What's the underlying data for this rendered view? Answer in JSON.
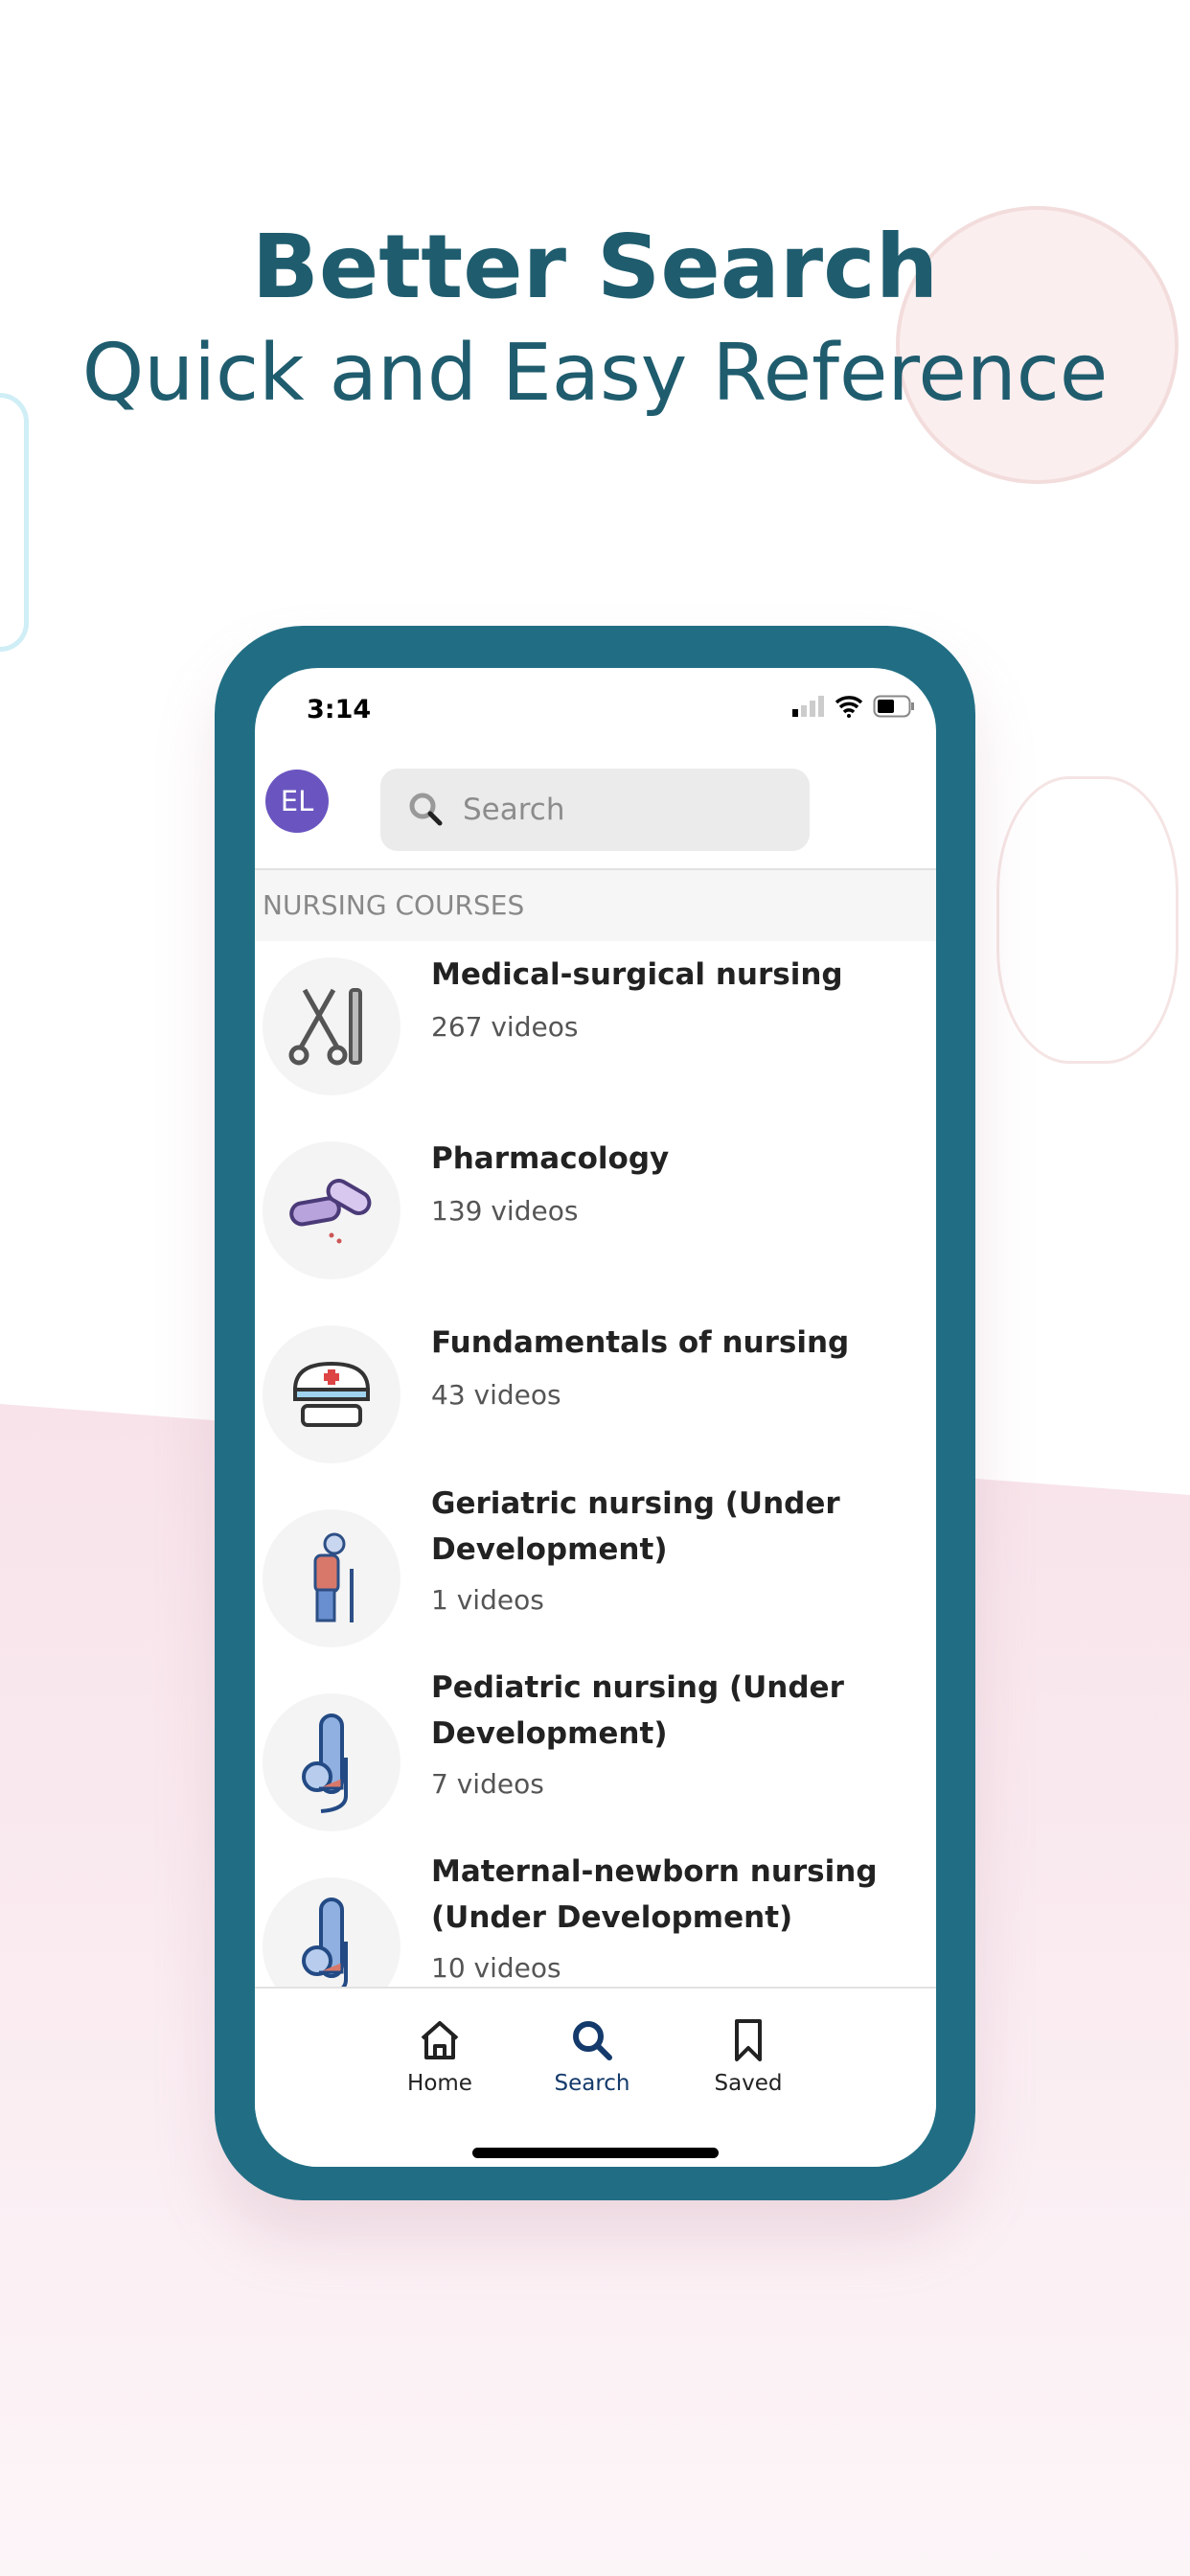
{
  "headline": {
    "title": "Better Search",
    "subtitle": "Quick and Easy Reference"
  },
  "colors": {
    "brand": "#1f5c6e",
    "frame": "#216e84",
    "avatar": "#6a55c0",
    "active_tab": "#143a6b"
  },
  "status_bar": {
    "time": "3:14"
  },
  "header": {
    "avatar_initials": "EL",
    "search_placeholder": "Search"
  },
  "section_title": "NURSING COURSES",
  "courses": [
    {
      "title": "Medical-surgical nursing",
      "count": "267 videos",
      "icon": "surgical-tools-icon"
    },
    {
      "title": "Pharmacology",
      "count": "139 videos",
      "icon": "pills-icon"
    },
    {
      "title": "Fundamentals of nursing",
      "count": "43 videos",
      "icon": "nurse-cap-icon"
    },
    {
      "title": "Geriatric nursing (Under Development)",
      "count": "1 videos",
      "icon": "elderly-person-icon"
    },
    {
      "title": "Pediatric nursing (Under Development)",
      "count": "7 videos",
      "icon": "mother-child-icon"
    },
    {
      "title": "Maternal-newborn nursing (Under Development)",
      "count": "10 videos",
      "icon": "mother-child-icon"
    }
  ],
  "tabs": [
    {
      "label": "Home",
      "icon": "home-icon"
    },
    {
      "label": "Search",
      "icon": "search-icon",
      "active": true
    },
    {
      "label": "Saved",
      "icon": "bookmark-icon"
    }
  ]
}
